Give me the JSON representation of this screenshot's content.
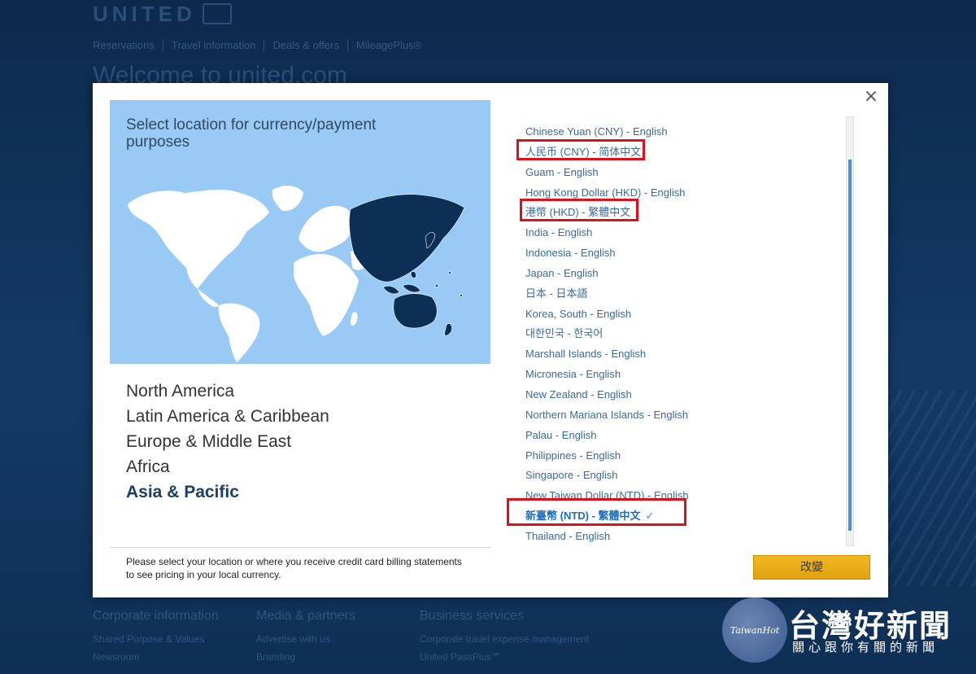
{
  "background": {
    "logo_text": "UNITED",
    "nav": [
      "Reservations",
      "Travel information",
      "Deals & offers",
      "MileagePlus®"
    ],
    "welcome": "Welcome to united.com",
    "footer_columns": [
      {
        "heading": "Corporate information",
        "links": [
          "Shared Purpose & Values",
          "Newsroom"
        ]
      },
      {
        "heading": "Media & partners",
        "links": [
          "Advertise with us",
          "Branding"
        ]
      },
      {
        "heading": "Business services",
        "links": [
          "Corporate travel expense management",
          "United PassPlus℠"
        ]
      }
    ]
  },
  "modal": {
    "title": "Select location for currency/payment purposes",
    "close_label": "×",
    "regions": [
      "North America",
      "Latin America & Caribbean",
      "Europe & Middle East",
      "Africa",
      "Asia & Pacific"
    ],
    "active_region": "Asia & Pacific",
    "note": "Please select your location or where you receive credit card billing statements to see pricing in your local currency.",
    "currencies": [
      "Chinese Yuan (CNY) - English",
      "人民币 (CNY) - 简体中文",
      "Guam - English",
      "Hong Kong Dollar (HKD) - English",
      "港幣 (HKD) - 繁體中文",
      "India - English",
      "Indonesia - English",
      "Japan - English",
      "日本 - 日本語",
      "Korea, South - English",
      "대한민국 - 한국어",
      "Marshall Islands - English",
      "Micronesia - English",
      "New Zealand - English",
      "Northern Mariana Islands - English",
      "Palau - English",
      "Philippines - English",
      "Singapore - English",
      "New Taiwan Dollar (NTD) - English",
      "新臺幣 (NTD) - 繁體中文",
      "Thailand - English"
    ],
    "selected_currency_index": 19,
    "check_mark": "✓",
    "change_button": "改變",
    "colors": {
      "accent": "#f2b824",
      "map_bg": "#99c9f5",
      "highlight_region": "#0d2f55",
      "annotation": "#e0101a"
    }
  },
  "watermark": {
    "circle_text": "TaiwanHot",
    "title": "台灣好新聞",
    "subtitle": "關心跟你有關的新聞"
  }
}
